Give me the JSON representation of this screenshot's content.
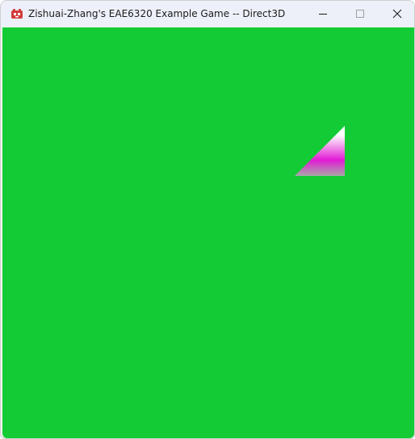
{
  "window": {
    "title": "Zishuai-Zhang's EAE6320 Example Game -- Direct3D",
    "icon": "game-app-icon",
    "buttons": {
      "minimize": "minimize-icon",
      "maximize": "maximize-icon",
      "close": "close-icon"
    }
  },
  "scene": {
    "clear_color": "#13cc35",
    "triangle": {
      "colors": {
        "top": "#ffffff",
        "middle": "#e21cd4",
        "bottom": "#a8a8a8"
      }
    }
  }
}
